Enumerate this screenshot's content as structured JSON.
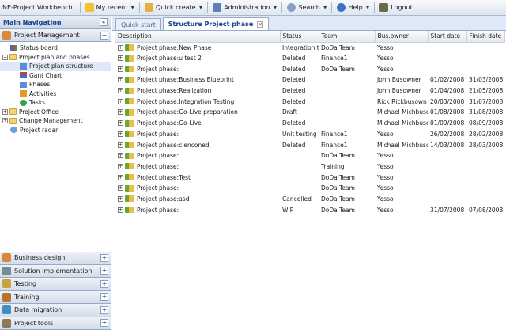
{
  "toolbar": {
    "app_title": "NE-Project Workbench",
    "my_recent": "My recent",
    "quick_create": "Quick create",
    "administration": "Administration",
    "search": "Search",
    "help": "Help",
    "logout": "Logout"
  },
  "nav": {
    "header": "Main Navigation",
    "collapse_glyph": "«",
    "section_title": "Project Management",
    "tree": [
      {
        "label": "Status board"
      },
      {
        "label": "Project plan and phases"
      },
      {
        "label": "Project plan structure"
      },
      {
        "label": "Gant Chart"
      },
      {
        "label": "Phases"
      },
      {
        "label": "Activities"
      },
      {
        "label": "Tasks"
      },
      {
        "label": "Project Office"
      },
      {
        "label": "Change Management"
      },
      {
        "label": "Project radar"
      }
    ],
    "bottom_sections": [
      {
        "label": "Business design"
      },
      {
        "label": "Solution implementation"
      },
      {
        "label": "Testing"
      },
      {
        "label": "Training"
      },
      {
        "label": "Data migration"
      },
      {
        "label": "Project tools"
      }
    ]
  },
  "tabs": [
    {
      "label": "Quick start"
    },
    {
      "label": "Structure Project phase"
    }
  ],
  "grid": {
    "columns": [
      "Description",
      "Status",
      "Team",
      "Bus.owner",
      "Start date",
      "Finish date"
    ],
    "rows": [
      [
        "Project phase:New Phase",
        "Integration tes",
        "DoDa Team",
        "Yesso",
        "",
        ""
      ],
      [
        "Project phase:u test 2",
        "Deleted",
        "Finance1",
        "Yesso",
        "",
        ""
      ],
      [
        "Project phase:",
        "Deleted",
        "DoDa Team",
        "Yesso",
        "",
        ""
      ],
      [
        "Project phase:Business Blueprint",
        "Deleted",
        "",
        "John Busowner",
        "01/02/2008",
        "31/03/2008"
      ],
      [
        "Project phase:Realization",
        "Deleted",
        "",
        "John Busowner",
        "01/04/2008",
        "21/05/2008"
      ],
      [
        "Project phase:Integration Testing",
        "Deleted",
        "",
        "Rick Rickbusown",
        "20/03/2008",
        "31/07/2008"
      ],
      [
        "Project phase:Go-Live preparation",
        "Draft",
        "",
        "Michael Michbusown",
        "01/08/2008",
        "31/08/2008"
      ],
      [
        "Project phase:Go-Live",
        "Deleted",
        "",
        "Michael Michbusown",
        "01/09/2008",
        "08/09/2008"
      ],
      [
        "Project phase:",
        "Unit testing",
        "Finance1",
        "Yesso",
        "26/02/2008",
        "28/02/2008"
      ],
      [
        "Project phase:clenconed",
        "Deleted",
        "Finance1",
        "Michael Michbusown",
        "14/03/2008",
        "28/03/2008"
      ],
      [
        "Project phase:",
        "",
        "DoDa Team",
        "Yesso",
        "",
        ""
      ],
      [
        "Project phase:",
        "",
        "Training",
        "Yesso",
        "",
        ""
      ],
      [
        "Project phase:Test",
        "",
        "DoDa Team",
        "Yesso",
        "",
        ""
      ],
      [
        "Project phase:",
        "",
        "DoDa Team",
        "Yesso",
        "",
        ""
      ],
      [
        "Project phase:asd",
        "Cancelled",
        "DoDa Team",
        "Yesso",
        "",
        ""
      ],
      [
        "Project phase:",
        "WIP",
        "DoDa Team",
        "Yesso",
        "31/07/2008",
        "07/08/2008"
      ]
    ]
  }
}
